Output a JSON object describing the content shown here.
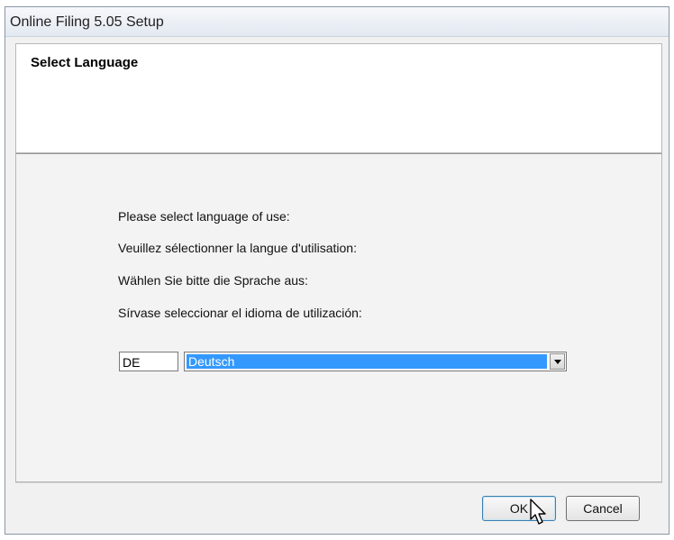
{
  "window": {
    "title": "Online Filing 5.05 Setup"
  },
  "header": {
    "title": "Select Language"
  },
  "prompts": [
    "Please select language of use:",
    "Veuillez sélectionner la langue d'utilisation:",
    "Wählen Sie bitte die Sprache aus:",
    "Sírvase seleccionar el idioma de utilización:"
  ],
  "language": {
    "code": "DE",
    "selected": "Deutsch"
  },
  "buttons": {
    "ok": "OK",
    "cancel": "Cancel"
  },
  "icons": {
    "dropdown": "chevron-down-icon",
    "cursor": "mouse-pointer-icon"
  }
}
